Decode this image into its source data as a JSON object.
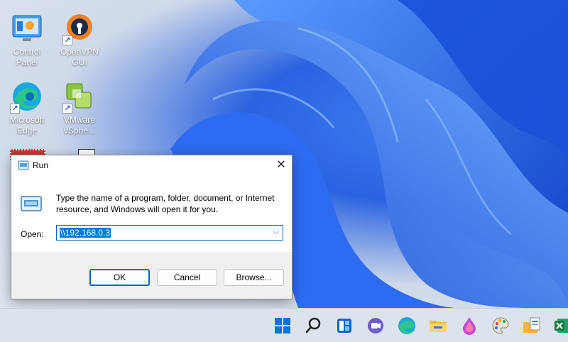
{
  "desktop": {
    "icons": [
      {
        "label": "Control Panel",
        "icon": "control-panel-icon"
      },
      {
        "label": "OpenVPN GUI",
        "icon": "openvpn-icon"
      },
      {
        "label": "Microsoft Edge",
        "icon": "edge-icon"
      },
      {
        "label": "VMware vSphe...",
        "icon": "vmware-icon"
      }
    ]
  },
  "run_dialog": {
    "title": "Run",
    "message": "Type the name of a program, folder, document, or Internet resource, and Windows will open it for you.",
    "open_label": "Open:",
    "open_value": "\\\\192.168.0.3",
    "ok_label": "OK",
    "cancel_label": "Cancel",
    "browse_label": "Browse...",
    "close_glyph": "✕",
    "dropdown_glyph": "⌵"
  },
  "taskbar": {
    "items": [
      "start-icon",
      "search-icon",
      "widgets-icon",
      "teams-chat-icon",
      "edge-icon",
      "file-explorer-icon",
      "paint-drop-icon",
      "palette-icon",
      "documents-icon",
      "excel-icon"
    ]
  },
  "colors": {
    "accent": "#0067c0",
    "selection": "#0078d7",
    "taskbar": "#dde3ec"
  }
}
